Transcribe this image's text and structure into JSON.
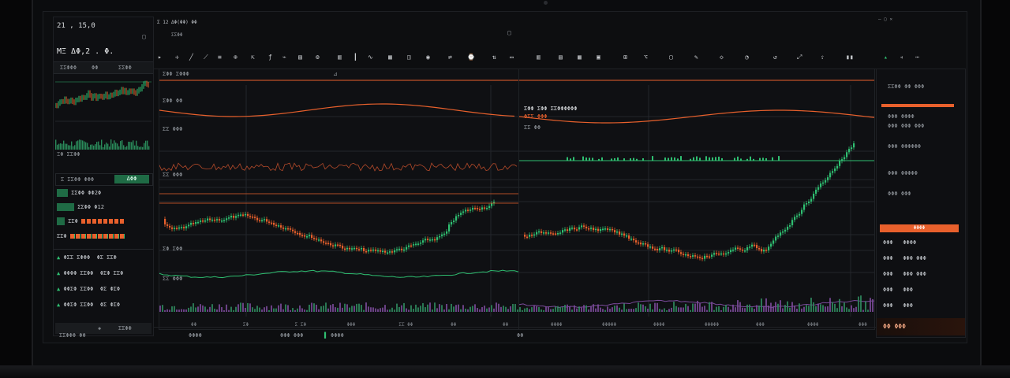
{
  "app": {
    "accent_orange": "#e8602c",
    "accent_green": "#2fbf71",
    "background": "#0d0e10"
  },
  "header": {
    "line1": "Σ 12 ΔΦ(ΦΦ) ΦΦ",
    "line2": "ΣΣΦΦ"
  },
  "left": {
    "title": "21 , 15,0",
    "ticker": "MΞ ΔΦ,2 . Φ.",
    "meta": [
      "ΣΣΦΦΦ",
      "ΦΦ",
      "ΣΣΦΦ"
    ],
    "quote": "ΞΦ ΣΣΦΦ",
    "buy_label": "ΔΦΦ",
    "book": [
      {
        "id": "ΣΣΦΦ",
        "price": "ΦΦ2Φ"
      },
      {
        "id": "ΣΣΦΦ",
        "price": "Φ12"
      },
      {
        "id": "ΣΣΦ",
        "price": "ΣΣΦ"
      },
      {
        "id": "ΣΣΦ",
        "price": "ΣΣΦ"
      }
    ],
    "orders": [
      {
        "a": "ΦΣΣ ΣΦΦΦ",
        "b": "ΦΣ ΣΣΦ"
      },
      {
        "a": "ΦΦΦΦ ΣΣΦΦ",
        "b": "ΦΣΦ ΣΣΦ"
      },
      {
        "a": "ΦΦΣΦ ΣΣΦΦ",
        "b": "ΦΣ ΦΣΦ"
      },
      {
        "a": "ΦΦΣΦ ΣΣΦΦ",
        "b": "ΦΣ ΦΣΦ"
      }
    ],
    "footer": "ΣΣΦΦ"
  },
  "chart_left": {
    "tab": "ΣΦΦ ΣΦΦΦ",
    "label1": "ΣΦΦ ΦΦ",
    "label2": "ΣΣ ΦΦΦ",
    "label3": "ΣΣ ΦΦΦ",
    "label4": "ΣΦ ΣΦΦ",
    "label5": "ΣΣ ΦΦΦ",
    "x_ticks": [
      "ΦΦ",
      "ΣΦ",
      "Σ ΣΦ",
      "ΦΦΦ",
      "ΣΣ ΦΦ",
      "ΦΦ",
      "ΦΦ"
    ]
  },
  "chart_right": {
    "title": "ΣΦΦ ΣΦΦ ΣΣΦΦΦΦΦΦ",
    "sub": "ΦΣΣ ΦΦΦ",
    "label": "ΣΣ ΦΦ",
    "x_ticks": [
      "ΦΦΦΦ",
      "ΦΦΦΦΦ",
      "ΦΦΦΦ",
      "ΦΦΦΦΦ",
      "ΦΦΦ",
      "ΦΦΦΦ",
      "ΦΦΦ"
    ]
  },
  "right": {
    "header": "ΣΣΦΦ ΦΦ ΦΦΦ",
    "action": "ΦΦΦΦ",
    "rows": [
      {
        "a": "ΦΦΦ",
        "b": "ΦΦΦΦ"
      },
      {
        "a": "ΦΦΦ",
        "b": "ΦΦΦ ΦΦΦ"
      },
      {
        "a": "ΦΦΦ",
        "b": "ΦΦΦ ΦΦΦ"
      },
      {
        "a": "ΦΦΦ",
        "b": "ΦΦΦ"
      },
      {
        "a": "ΦΦΦ",
        "b": "ΦΦΦ"
      }
    ],
    "bottom": "ΦΦ ΦΦΦ"
  },
  "statusbar": {
    "left": "ΣΣΦΦΦ ΦΦ",
    "mid1": "ΦΦΦΦ",
    "mid2": "ΦΦΦ ΦΦΦ",
    "mid3": "ΦΦΦΦ",
    "right": "ΦΦ"
  }
}
